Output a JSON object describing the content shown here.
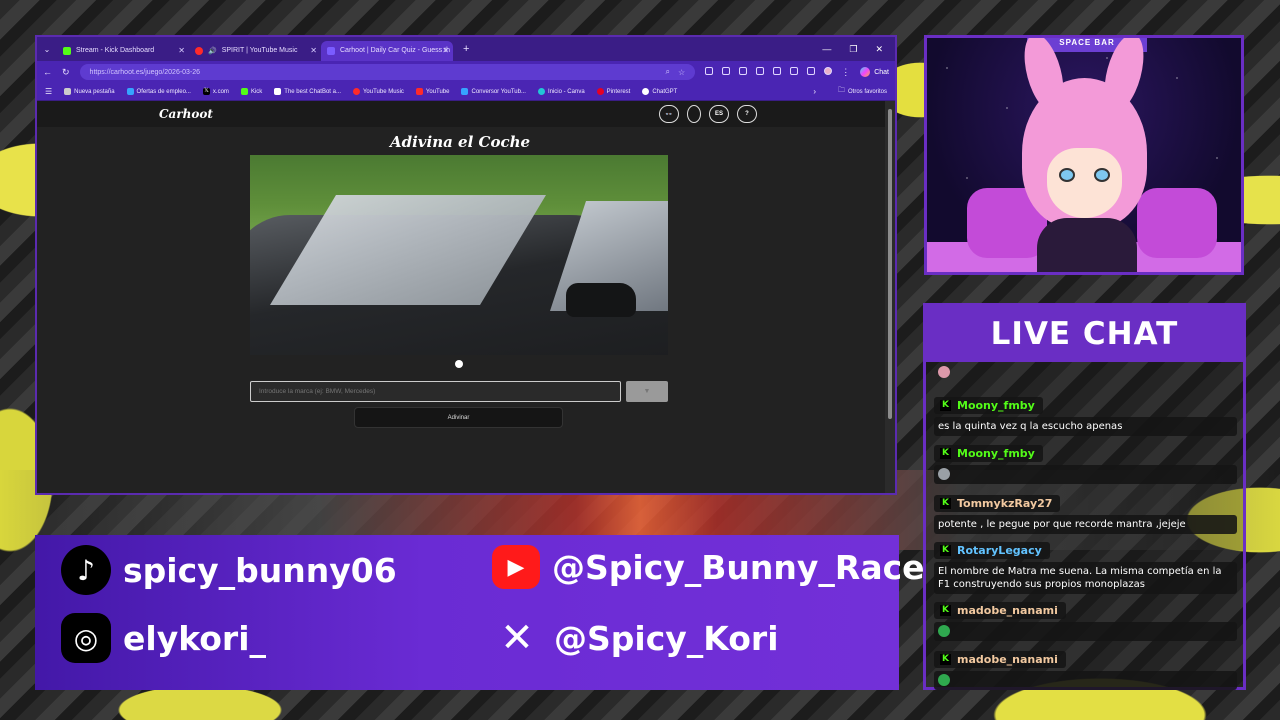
{
  "browser": {
    "tabs": [
      {
        "label": "Stream - Kick Dashboard",
        "active": false,
        "color": "#53fc18"
      },
      {
        "label": "SPIRIT | YouTube Music",
        "active": false,
        "color": "#ff2a2a"
      },
      {
        "label": "Carhoot | Daily Car Quiz - Guess th",
        "active": true,
        "color": "#7a5cff"
      }
    ],
    "url": "https://carhoot.es/juego/2026-03-26",
    "chat_label": "Chat",
    "bookmarks": [
      {
        "label": "Nueva pestaña",
        "color": "#cccccc"
      },
      {
        "label": "Ofertas de empleo...",
        "color": "#36a3ff"
      },
      {
        "label": "x.com",
        "color": "#000000"
      },
      {
        "label": "Kick",
        "color": "#53fc18"
      },
      {
        "label": "The best ChatBot a...",
        "color": "#ffffff"
      },
      {
        "label": "YouTube Music",
        "color": "#ff2a2a"
      },
      {
        "label": "YouTube",
        "color": "#ff2a2a"
      },
      {
        "label": "Conversor YouTub...",
        "color": "#36a3ff"
      },
      {
        "label": "Inicio - Canva",
        "color": "#22c6d6"
      },
      {
        "label": "Pinterest",
        "color": "#e60023"
      },
      {
        "label": "ChatGPT",
        "color": "#ffffff"
      }
    ],
    "other_bookmarks": "Otros favoritos"
  },
  "site": {
    "logo": "Carhoot",
    "nav_icons": [
      {
        "label": "👓",
        "name": "mask-icon"
      },
      {
        "label": "",
        "name": "theme-circle-icon"
      },
      {
        "label": "ES",
        "name": "language-button"
      },
      {
        "label": "?",
        "name": "help-button"
      }
    ],
    "title": "Adivina el Coche",
    "input_placeholder": "Introduce la marca (ej: BMW, Mercedes)",
    "dropdown_symbol": "▼",
    "guess_button": "Adivinar"
  },
  "chat": {
    "title": "LIVE CHAT",
    "messages": [
      {
        "user": "Moony_fmby",
        "color": "#53fc18",
        "text": "es la quinta vez q la escucho apenas"
      },
      {
        "user": "Moony_fmby",
        "color": "#53fc18",
        "text": "",
        "emote": "#9aa0a6"
      },
      {
        "user": "TommykzRay27",
        "color": "#f2c9a0",
        "text": "potente , le pegue por que recorde mantra ,jejeje"
      },
      {
        "user": "RotaryLegacy",
        "color": "#62c3ff",
        "text": "El nombre de Matra me suena. La misma competía en la F1 construyendo sus propios monoplazas"
      },
      {
        "user": "madobe_nanami",
        "color": "#f2c9a0",
        "text": "",
        "emote": "#2fa84f"
      },
      {
        "user": "madobe_nanami",
        "color": "#f2c9a0",
        "text": "",
        "emote": "#2fa84f"
      }
    ]
  },
  "socials": {
    "tiktok": "spicy_bunny06",
    "youtube": "@Spicy_Bunny_Race",
    "instagram": "elykori_",
    "x": "@Spicy_Kori"
  },
  "avatar": {
    "sign": "SPACE BAR"
  }
}
